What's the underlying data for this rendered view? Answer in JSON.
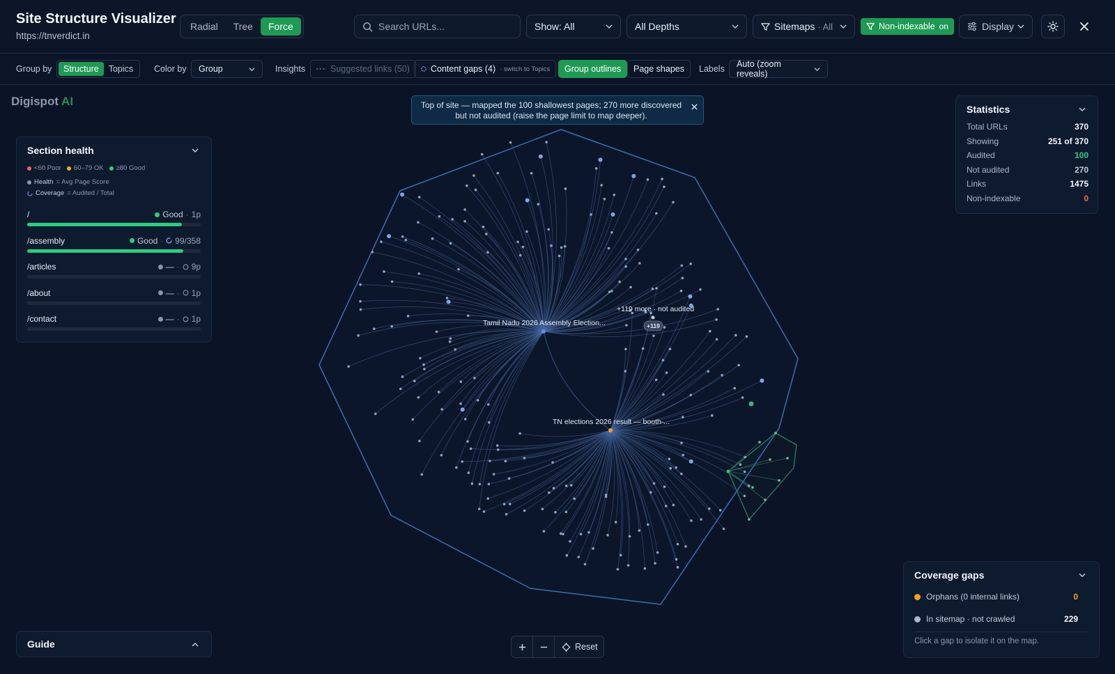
{
  "app": {
    "title": "Site Structure Visualizer",
    "url": "https://tnverdict.in"
  },
  "layout_modes": {
    "items": [
      "Radial",
      "Tree",
      "Force"
    ],
    "active": "Force"
  },
  "search": {
    "placeholder": "Search URLs..."
  },
  "filters": {
    "show": "Show: All",
    "depth": "All Depths",
    "sitemaps_label": "Sitemaps",
    "sitemaps_value": "· All",
    "nonindexable_label": "Non-indexable",
    "nonindexable_state": "on",
    "display_label": "Display"
  },
  "toolbar": {
    "group_by_label": "Group by",
    "group_by_options": [
      "Structure",
      "Topics"
    ],
    "group_by_active": "Structure",
    "color_by_label": "Color by",
    "color_by_value": "Group",
    "insights_label": "Insights",
    "suggested_links": "Suggested links (50)",
    "content_gaps": "Content gaps (4)",
    "content_gaps_sub": "· switch to Topics",
    "group_outlines": "Group outlines",
    "page_shapes": "Page shapes",
    "labels_label": "Labels",
    "labels_value": "Auto (zoom reveals)"
  },
  "brand": {
    "name": "Digispot",
    "suffix": "AI"
  },
  "banner": {
    "text": "Top of site — mapped the 100 shallowest pages; 270 more discovered but not audited (raise the page limit to map deeper)."
  },
  "section_health": {
    "title": "Section health",
    "legend": {
      "poor": "<60 Poor",
      "ok": "60–79 OK",
      "good": "≥80 Good",
      "health": "Health",
      "health_def": "= Avg Page Score",
      "coverage": "Coverage",
      "coverage_def": "= Audited / Total"
    },
    "rows": [
      {
        "path": "/",
        "status": "Good",
        "count": "1p",
        "fill": 0.89
      },
      {
        "path": "/assembly",
        "status": "Good",
        "count": "99/358",
        "fill": 0.9
      },
      {
        "path": "/articles",
        "status": "—",
        "count": "9p",
        "fill": 0
      },
      {
        "path": "/about",
        "status": "—",
        "count": "1p",
        "fill": 0
      },
      {
        "path": "/contact",
        "status": "—",
        "count": "1p",
        "fill": 0
      }
    ]
  },
  "guide": {
    "title": "Guide"
  },
  "statistics": {
    "title": "Statistics",
    "rows": [
      {
        "label": "Total URLs",
        "value": "370",
        "color": "#f4f7fc"
      },
      {
        "label": "Showing",
        "value": "251 of 370",
        "color": "#f4f7fc"
      },
      {
        "label": "Audited",
        "value": "100",
        "color": "#2ecc80"
      },
      {
        "label": "Not audited",
        "value": "270",
        "color": "#c3ccd9"
      },
      {
        "label": "Links",
        "value": "1475",
        "color": "#f4f7fc"
      },
      {
        "label": "Non-indexable",
        "value": "0",
        "color": "#f0685c"
      }
    ]
  },
  "coverage_gaps": {
    "title": "Coverage gaps",
    "orphans_label": "Orphans (0 internal links)",
    "orphans_value": "0",
    "sitemap_label": "In sitemap · not crawled",
    "sitemap_value": "229",
    "hint": "Click a gap to isolate it on the map."
  },
  "graph": {
    "hub1_label": "Tamil Nadu 2026 Assembly Election...",
    "hub2_label": "TN elections 2026 result — booth-...",
    "more_label": "+119 more · not audited",
    "more_badge": "+119"
  },
  "zoom": {
    "reset_label": "Reset"
  },
  "colors": {
    "accent": "#1f9a55",
    "outline": "#3a6fb0",
    "node": "#8fa2c4",
    "edge": "#4a6ca6",
    "hub2": "#f0a030",
    "cluster": "#3aa372"
  }
}
